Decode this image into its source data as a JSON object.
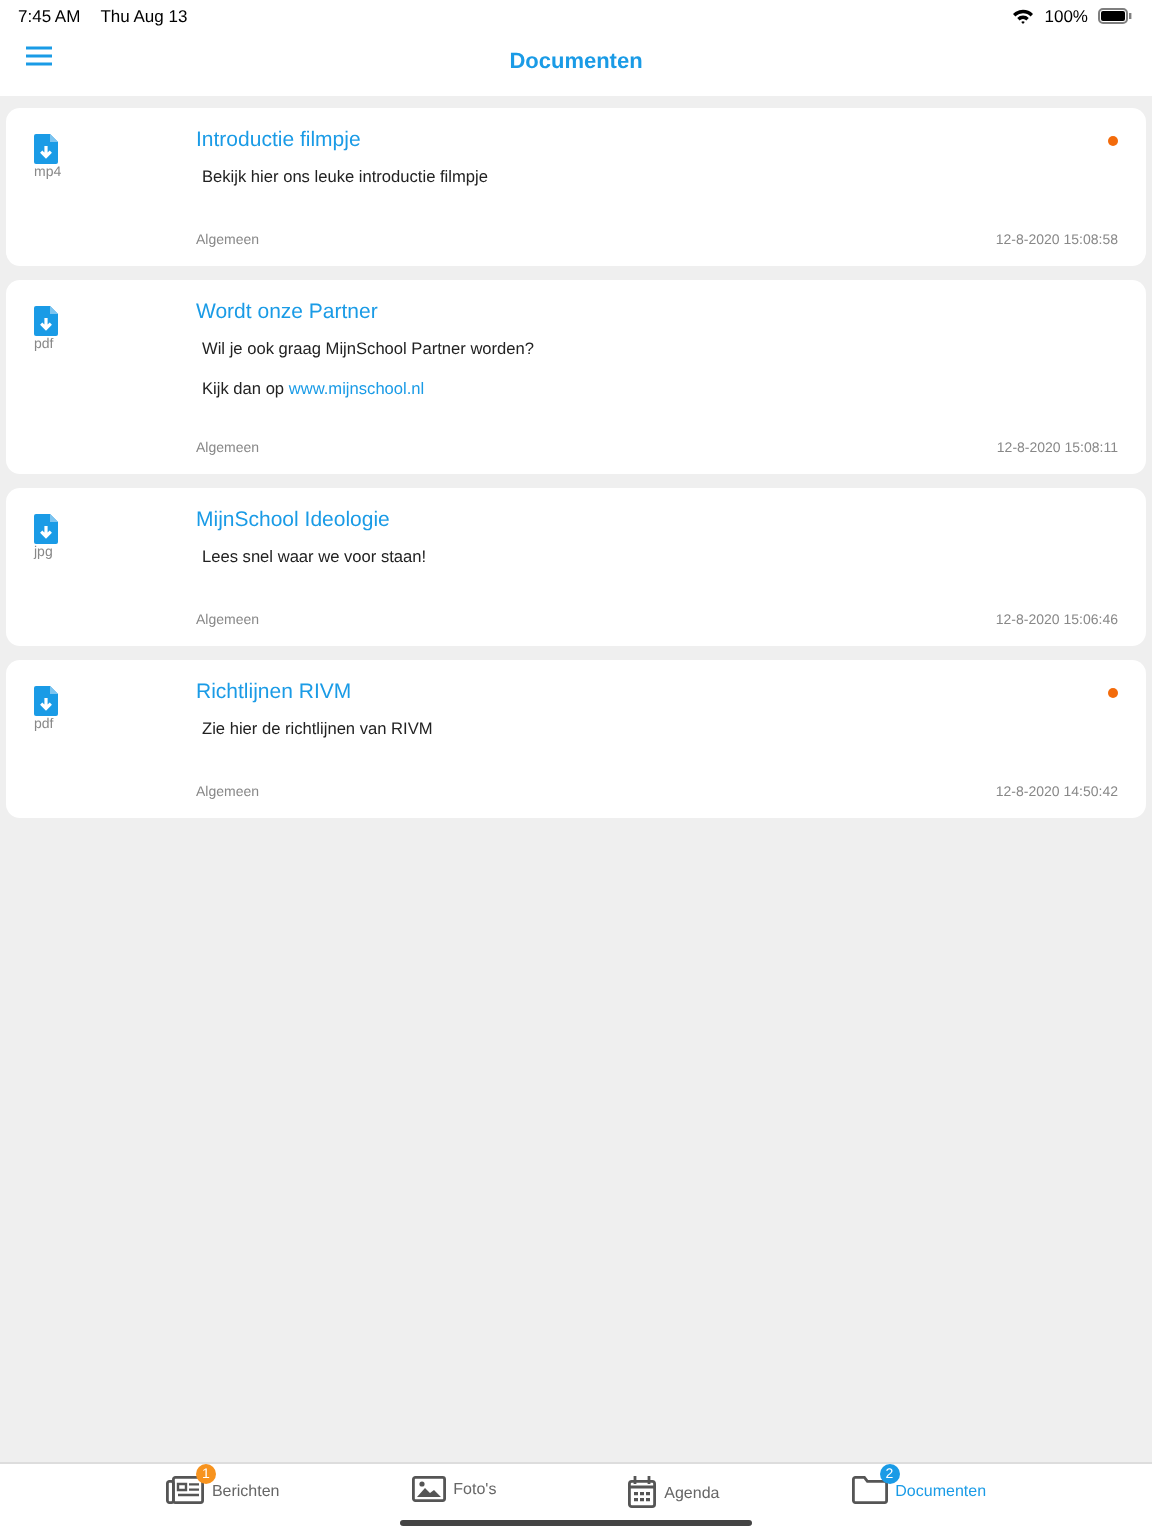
{
  "status_bar": {
    "time": "7:45 AM",
    "date": "Thu Aug 13",
    "battery": "100%"
  },
  "nav": {
    "title": "Documenten"
  },
  "documents": [
    {
      "file_type": "mp4",
      "title": "Introductie filmpje",
      "unread": true,
      "body": [
        {
          "text": "Bekijk hier ons leuke introductie filmpje"
        }
      ],
      "category": "Algemeen",
      "timestamp": "12-8-2020 15:08:58"
    },
    {
      "file_type": "pdf",
      "title": "Wordt onze Partner",
      "unread": false,
      "body": [
        {
          "text": "Wil je ook graag MijnSchool Partner worden?"
        },
        {
          "text": "Kijk dan op ",
          "link": "www.mijnschool.nl"
        }
      ],
      "category": "Algemeen",
      "timestamp": "12-8-2020 15:08:11"
    },
    {
      "file_type": "jpg",
      "title": "MijnSchool Ideologie",
      "unread": false,
      "body": [
        {
          "text": "Lees snel waar we voor staan!"
        }
      ],
      "category": "Algemeen",
      "timestamp": "12-8-2020 15:06:46"
    },
    {
      "file_type": "pdf",
      "title": "Richtlijnen RIVM",
      "unread": true,
      "body": [
        {
          "text": "Zie hier de richtlijnen van RIVM"
        }
      ],
      "category": "Algemeen",
      "timestamp": "12-8-2020 14:50:42"
    }
  ],
  "tab_bar": [
    {
      "kind": "news",
      "label": "Berichten",
      "selected": false,
      "badge": "1",
      "color": "#f7931e"
    },
    {
      "kind": "photos",
      "label": "Foto's",
      "selected": false
    },
    {
      "kind": "calendar",
      "label": "Agenda",
      "selected": false
    },
    {
      "kind": "folder",
      "label": "Documenten",
      "selected": true,
      "badge": "2",
      "color": "#1a9be6"
    }
  ]
}
